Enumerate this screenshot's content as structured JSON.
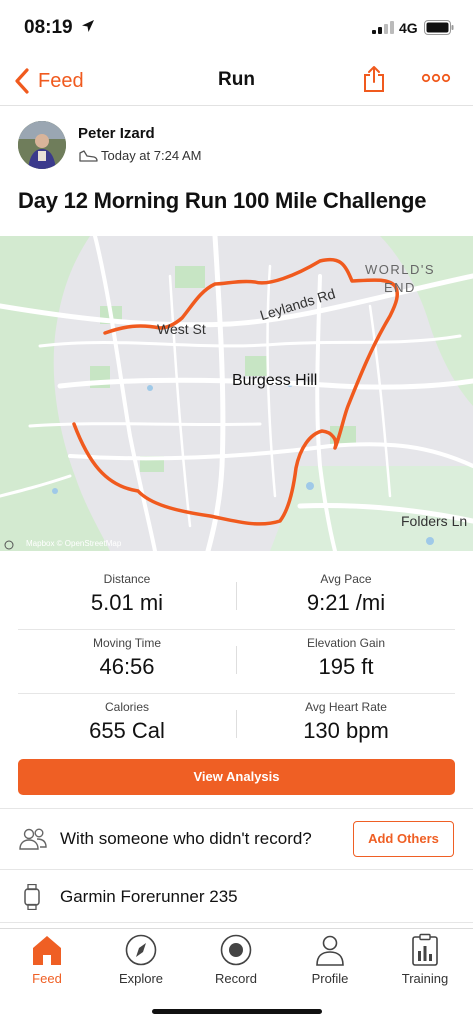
{
  "status_bar": {
    "time": "08:19",
    "network": "4G"
  },
  "nav": {
    "back_label": "Feed",
    "title": "Run"
  },
  "athlete": {
    "name": "Peter Izard",
    "time": "Today at 7:24 AM"
  },
  "activity": {
    "title": "Day 12 Morning Run 100 Mile Challenge"
  },
  "map": {
    "labels": {
      "worlds": "WORLD'S",
      "end": "END",
      "leylands": "Leylands Rd",
      "west": "West St",
      "burgess": "Burgess Hill",
      "folders": "Folders Ln",
      "attribution": "Mapbox © OpenStreetMap"
    },
    "route_color": "#f05a1e"
  },
  "stats": [
    {
      "left_label": "Distance",
      "left_value": "5.01 mi",
      "right_label": "Avg Pace",
      "right_value": "9:21 /mi"
    },
    {
      "left_label": "Moving Time",
      "left_value": "46:56",
      "right_label": "Elevation Gain",
      "right_value": "195 ft"
    },
    {
      "left_label": "Calories",
      "left_value": "655 Cal",
      "right_label": "Avg Heart Rate",
      "right_value": "130 bpm"
    }
  ],
  "view_analysis_label": "View Analysis",
  "others": {
    "text": "With someone who didn't record?",
    "button": "Add Others"
  },
  "device": {
    "name": "Garmin Forerunner 235"
  },
  "tabs": [
    {
      "label": "Feed",
      "icon": "home-icon"
    },
    {
      "label": "Explore",
      "icon": "compass-icon"
    },
    {
      "label": "Record",
      "icon": "record-icon"
    },
    {
      "label": "Profile",
      "icon": "profile-icon"
    },
    {
      "label": "Training",
      "icon": "training-icon"
    }
  ],
  "colors": {
    "accent": "#f05a1e",
    "button": "#ef5f24"
  }
}
